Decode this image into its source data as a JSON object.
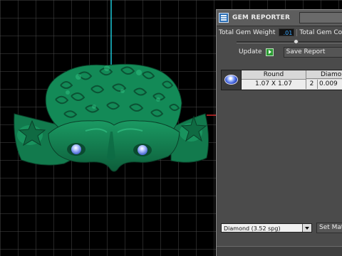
{
  "panel": {
    "title": "GEM REPORTER",
    "total_weight_label": "Total Gem Weight",
    "total_weight_value": ".01",
    "gem_count_label": "Total Gem Co",
    "update_label": "Update",
    "save_report_label": "Save Report",
    "slider_position": 0.5
  },
  "report": {
    "columns": [
      "Round",
      "Diamo"
    ],
    "rows": [
      {
        "size": "1.07 X 1.07",
        "count": "2",
        "weight": "0.009"
      }
    ]
  },
  "material": {
    "selected": "Diamond    (3.52 spg)",
    "set_label": "Set Mat"
  },
  "colors": {
    "model": "#138a57",
    "gems": "#9fb8ff",
    "axis_y": "#1bc6d6",
    "axis_x": "#d32a2a",
    "panel": "#4b4b4b"
  }
}
